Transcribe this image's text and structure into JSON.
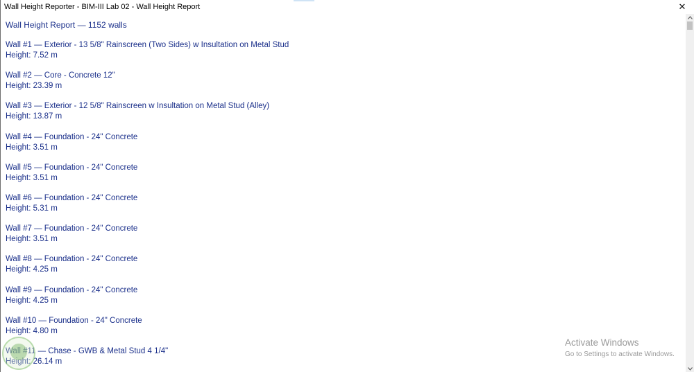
{
  "window": {
    "title": "Wall Height Reporter - BIM-III Lab 02 - Wall Height Report",
    "close_label": "✕"
  },
  "report": {
    "header": "Wall Height Report — 1152 walls",
    "walls": [
      {
        "title": "Wall #1 — Exterior - 13 5/8\" Rainscreen (Two Sides) w Insultation on Metal Stud",
        "height": "Height: 7.52 m"
      },
      {
        "title": "Wall #2 — Core - Concrete 12\"",
        "height": "Height: 23.39 m"
      },
      {
        "title": "Wall #3 — Exterior - 12 5/8\" Rainscreen w Insultation on Metal Stud (Alley)",
        "height": "Height: 13.87 m"
      },
      {
        "title": "Wall #4 — Foundation - 24\" Concrete",
        "height": "Height: 3.51 m"
      },
      {
        "title": "Wall #5 — Foundation - 24\" Concrete",
        "height": "Height: 3.51 m"
      },
      {
        "title": "Wall #6 — Foundation - 24\" Concrete",
        "height": "Height: 5.31 m"
      },
      {
        "title": "Wall #7 — Foundation - 24\" Concrete",
        "height": "Height: 3.51 m"
      },
      {
        "title": "Wall #8 — Foundation - 24\" Concrete",
        "height": "Height: 4.25 m"
      },
      {
        "title": "Wall #9 — Foundation - 24\" Concrete",
        "height": "Height: 4.25 m"
      },
      {
        "title": "Wall #10 — Foundation - 24\" Concrete",
        "height": "Height: 4.80 m"
      },
      {
        "title": "Wall #11 — Chase - GWB & Metal Stud 4 1/4\"",
        "height": "Height: 26.14 m"
      }
    ]
  },
  "watermark": {
    "title": "Activate Windows",
    "subtitle": "Go to Settings to activate Windows."
  },
  "colors": {
    "text_blue": "#1a2f8a",
    "watermark_gray": "#9a9a9a"
  }
}
